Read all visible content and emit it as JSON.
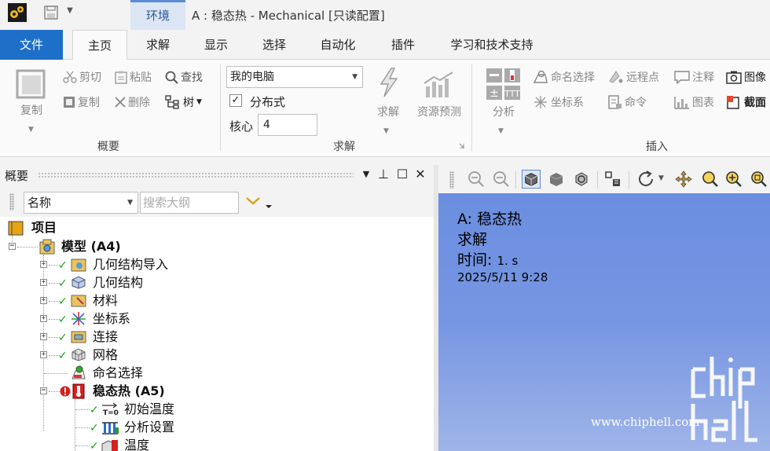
{
  "titlebar": {
    "context_tab": "环境",
    "window_title": "A : 稳态热 - Mechanical [只读配置]"
  },
  "tabs": [
    "文件",
    "主页",
    "求解",
    "显示",
    "选择",
    "自动化",
    "插件",
    "学习和技术支持"
  ],
  "ribbon": {
    "outline_group": {
      "label": "概要",
      "copy_big": "复制",
      "cut": "剪切",
      "paste": "粘贴",
      "find": "查找",
      "duplicate": "复制",
      "delete": "删除",
      "tree": "树"
    },
    "solve_group": {
      "label": "求解",
      "machine": "我的电脑",
      "distributed": "分布式",
      "distributed_checked": true,
      "cores_label": "核心",
      "cores_value": "4",
      "solve_btn": "求解",
      "resource_predict": "资源预测"
    },
    "insert_group": {
      "label": "插入",
      "analysis": "分析",
      "named_selection": "命名选择",
      "remote_point": "远程点",
      "annotation": "注释",
      "image": "图像",
      "coordinate_system": "坐标系",
      "command": "命令",
      "chart": "图表",
      "section": "截面"
    }
  },
  "outline": {
    "title": "概要",
    "filter_combo": "名称",
    "search_placeholder": "搜索大纲",
    "tree": [
      {
        "label": "项目",
        "bold": true
      },
      {
        "label": "模型 (A4)",
        "bold": true
      },
      {
        "label": "几何结构导入",
        "bold": false
      },
      {
        "label": "几何结构",
        "bold": false
      },
      {
        "label": "材料",
        "bold": false
      },
      {
        "label": "坐标系",
        "bold": false
      },
      {
        "label": "连接",
        "bold": false
      },
      {
        "label": "网格",
        "bold": false
      },
      {
        "label": "命名选择",
        "bold": false
      },
      {
        "label": "稳态热 (A5)",
        "bold": true
      },
      {
        "label": "初始温度",
        "bold": false
      },
      {
        "label": "分析设置",
        "bold": false
      },
      {
        "label": "温度",
        "bold": false
      }
    ]
  },
  "viewport": {
    "line1": "A: 稳态热",
    "line2": "求解",
    "line3_label": "时间:",
    "line3_value": "1. s",
    "line4": "2025/5/11 9:28",
    "watermark_url": "www.chiphell.com",
    "background_color": "#7393e1"
  },
  "colors": {
    "file_tab": "#1e6fc8",
    "context_tab_bg": "#dce6f4",
    "check_green": "#1aa01a"
  }
}
